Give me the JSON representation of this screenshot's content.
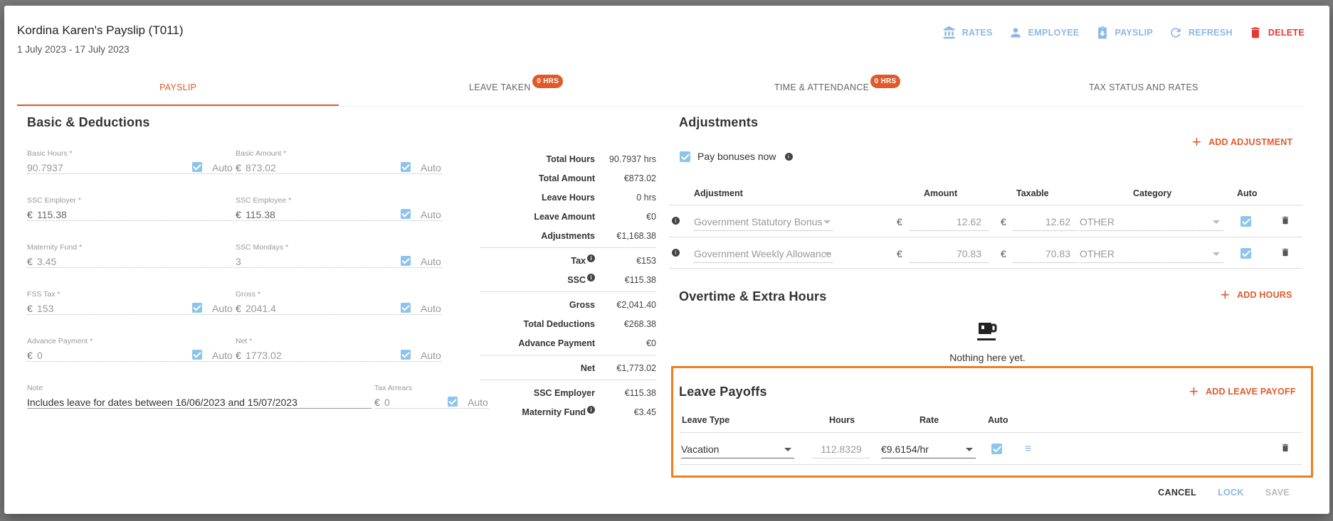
{
  "header": {
    "title": "Kordina Karen's Payslip (T011)",
    "subtitle": "1 July 2023 - 17 July 2023"
  },
  "actions": {
    "rates": "RATES",
    "employee": "EMPLOYEE",
    "payslip": "PAYSLIP",
    "refresh": "REFRESH",
    "delete": "DELETE"
  },
  "tabs": {
    "payslip": "PAYSLIP",
    "leave_taken": "LEAVE TAKEN",
    "leave_badge": "0 HRS",
    "time_attendance": "TIME & ATTENDANCE",
    "time_badge": "0 HRS",
    "tax_status": "TAX STATUS AND RATES"
  },
  "basic": {
    "title": "Basic & Deductions",
    "currency": "€",
    "auto": "Auto",
    "basic_hours_label": "Basic Hours *",
    "basic_hours": "90.7937",
    "basic_amount_label": "Basic Amount *",
    "basic_amount": "873.02",
    "ssc_employer_label": "SSC Employer *",
    "ssc_employer": "115.38",
    "ssc_employee_label": "SSC Employee *",
    "ssc_employee": "115.38",
    "maternity_label": "Maternity Fund *",
    "maternity": "3.45",
    "ssc_mondays_label": "SSC Mondays *",
    "ssc_mondays": "3",
    "fss_label": "FSS Tax *",
    "fss": "153",
    "gross_label": "Gross *",
    "gross": "2041.4",
    "advance_label": "Advance Payment *",
    "advance": "0",
    "net_label": "Net *",
    "net": "1773.02",
    "note_label": "Note",
    "note": "Includes leave for dates between 16/06/2023 and 15/07/2023",
    "arrears_label": "Tax Arrears",
    "arrears": "0"
  },
  "summary": {
    "total_hours_k": "Total Hours",
    "total_hours_v": "90.7937 hrs",
    "total_amount_k": "Total Amount",
    "total_amount_v": "€873.02",
    "leave_hours_k": "Leave Hours",
    "leave_hours_v": "0 hrs",
    "leave_amount_k": "Leave Amount",
    "leave_amount_v": "€0",
    "adjustments_k": "Adjustments",
    "adjustments_v": "€1,168.38",
    "tax_k": "Tax",
    "tax_v": "€153",
    "ssc_k": "SSC",
    "ssc_v": "€115.38",
    "gross_k": "Gross",
    "gross_v": "€2,041.40",
    "total_ded_k": "Total Deductions",
    "total_ded_v": "€268.38",
    "advance_k": "Advance Payment",
    "advance_v": "€0",
    "net_k": "Net",
    "net_v": "€1,773.02",
    "ssc_employer_k": "SSC Employer",
    "ssc_employer_v": "€115.38",
    "maternity_k": "Maternity Fund",
    "maternity_v": "€3.45"
  },
  "adjustments": {
    "title": "Adjustments",
    "add": "ADD ADJUSTMENT",
    "pay_bonuses": "Pay bonuses now",
    "col_adjustment": "Adjustment",
    "col_amount": "Amount",
    "col_taxable": "Taxable",
    "col_category": "Category",
    "col_auto": "Auto",
    "rows": [
      {
        "name": "Government Statutory Bonus",
        "currency": "€",
        "amount": "12.62",
        "taxable": "12.62",
        "category": "OTHER"
      },
      {
        "name": "Government Weekly Allowance",
        "currency": "€",
        "amount": "70.83",
        "taxable": "70.83",
        "category": "OTHER"
      }
    ]
  },
  "overtime": {
    "title": "Overtime & Extra Hours",
    "add": "ADD HOURS",
    "empty": "Nothing here yet."
  },
  "leave_payoffs": {
    "title": "Leave Payoffs",
    "add": "ADD LEAVE PAYOFF",
    "col_type": "Leave Type",
    "col_hours": "Hours",
    "col_rate": "Rate",
    "col_auto": "Auto",
    "row": {
      "type": "Vacation",
      "hours": "112.8329",
      "rate": "€9.6154/hr"
    }
  },
  "footer": {
    "cancel": "CANCEL",
    "lock": "LOCK",
    "save": "SAVE"
  },
  "colors": {
    "accent": "#e05a2b",
    "link": "#8cb8e6",
    "danger": "#e53935",
    "highlight": "#f07d1e"
  }
}
